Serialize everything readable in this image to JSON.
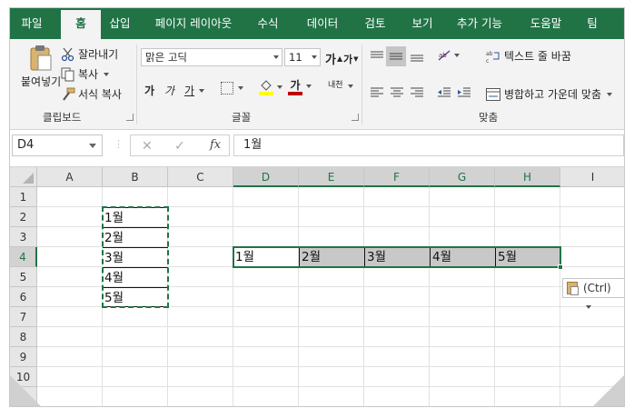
{
  "tabs": [
    {
      "label": "파일",
      "active": false
    },
    {
      "label": "홈",
      "active": true
    },
    {
      "label": "삽입",
      "active": false
    },
    {
      "label": "페이지 레이아웃",
      "active": false
    },
    {
      "label": "수식",
      "active": false
    },
    {
      "label": "데이터",
      "active": false
    },
    {
      "label": "검토",
      "active": false
    },
    {
      "label": "보기",
      "active": false
    },
    {
      "label": "추가 기능",
      "active": false
    },
    {
      "label": "도움말",
      "active": false
    },
    {
      "label": "팀",
      "active": false
    }
  ],
  "clipboard": {
    "paste_label": "붙여넣기",
    "cut_label": "잘라내기",
    "copy_label": "복사",
    "format_painter_label": "서식 복사",
    "group_label": "클립보드"
  },
  "font": {
    "font_name": "맑은 고딕",
    "font_size": "11",
    "grow_label": "가",
    "shrink_label": "가",
    "bold_label": "가",
    "italic_label": "가",
    "underline_label": "가",
    "font_color_label": "가",
    "phonetic_label": "내천",
    "group_label": "글꼴",
    "fill_color": "#ffff00",
    "font_color": "#c00000"
  },
  "alignment": {
    "wrap_label": "텍스트 줄 바꿈",
    "merge_label": "병합하고 가운데 맞춤",
    "group_label": "맞춤"
  },
  "formula_bar": {
    "name_box": "D4",
    "cancel_symbol": "✕",
    "enter_symbol": "✓",
    "fx_symbol": "fx",
    "value": "1월"
  },
  "grid": {
    "columns": [
      "A",
      "B",
      "C",
      "D",
      "E",
      "F",
      "G",
      "H",
      "I"
    ],
    "selected_columns": [
      "D",
      "E",
      "F",
      "G",
      "H"
    ],
    "rows": [
      "1",
      "2",
      "3",
      "4",
      "5",
      "6",
      "7",
      "8",
      "9",
      "10",
      "11"
    ],
    "selected_row": "4",
    "column_b": [
      "1월",
      "2월",
      "3월",
      "4월",
      "5월"
    ],
    "row_4": [
      "1월",
      "2월",
      "3월",
      "4월",
      "5월"
    ]
  },
  "paste_options": {
    "label": "(Ctrl)"
  },
  "colors": {
    "accent": "#217346",
    "ribbon_bg": "#f3f3f3",
    "header_bg": "#e6e6e6",
    "selected_shade": "#c8c8c8"
  }
}
